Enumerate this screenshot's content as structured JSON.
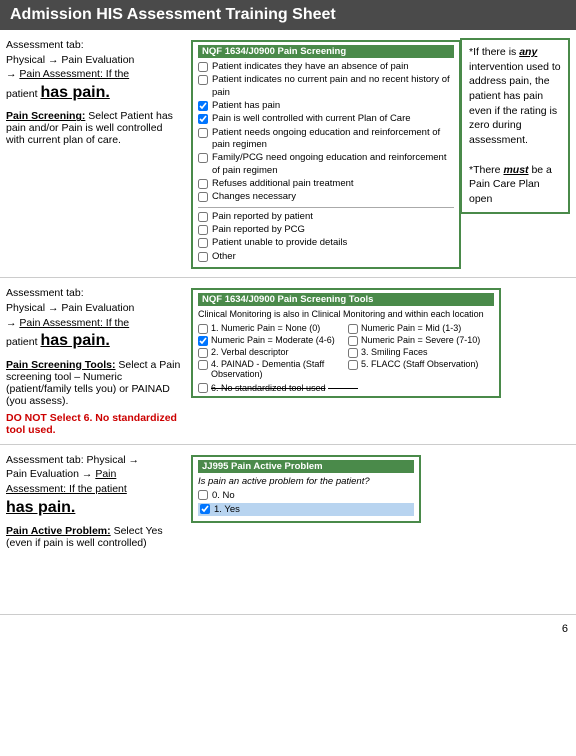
{
  "header": {
    "title": "Admission HIS Assessment Training Sheet"
  },
  "sections": [
    {
      "id": "section1",
      "left": {
        "line1": "Assessment tab:",
        "line2": "Physical → Pain Evaluation",
        "line3": "→ Pain Assessment: If the",
        "line4": "patient",
        "has_pain": "has pain.",
        "blank": "",
        "subheading": "Pain Screening:",
        "subheading_rest": " Select Patient has pain and/or Pain is well controlled with current plan of care."
      },
      "right": {
        "nqf_title": "NQF 1634/J0900 Pain Screening",
        "items": [
          {
            "checked": false,
            "label": "Patient indicates they have an absence of pain"
          },
          {
            "checked": false,
            "label": "Patient indicates no current pain and no recent history of pain"
          },
          {
            "checked": true,
            "label": "Patient has pain"
          },
          {
            "checked": true,
            "label": "Pain is well controlled with current Plan of Care"
          },
          {
            "checked": false,
            "label": "Patient needs ongoing education and reinforcement of pain regimen"
          },
          {
            "checked": false,
            "label": "Family/PCG need ongoing education and reinforcement of pain regimen"
          },
          {
            "checked": false,
            "label": "Refuses additional pain treatment"
          },
          {
            "checked": false,
            "label": "Changes necessary"
          }
        ],
        "divider": true,
        "subitems": [
          {
            "checked": false,
            "label": "Pain reported by patient"
          },
          {
            "checked": false,
            "label": "Pain reported by PCG"
          },
          {
            "checked": false,
            "label": "Patient unable to provide details"
          },
          {
            "checked": false,
            "label": "Other"
          }
        ],
        "note": {
          "line1": "*If there is",
          "any": "any",
          "line2": "intervention used to address pain, the patient has pain even if the rating is zero during assessment.",
          "line3": "",
          "must": "must",
          "line4": "*There",
          "line5": "be a Pain Care Plan open"
        }
      }
    },
    {
      "id": "section2",
      "left": {
        "line1": "Assessment tab:",
        "line2": "Physical → Pain Evaluation",
        "line3": "→ Pain Assessment: If the",
        "line4": "patient",
        "has_pain": "has pain.",
        "blank": "",
        "subheading": "Pain Screening Tools:",
        "subheading_rest": " Select a Pain screening tool – Numeric (patient/family tells you) or PAINAD (you assess).",
        "do_not": "DO NOT Select 6. No standardized tool used."
      },
      "right": {
        "nqf_title": "NQF 1634/J0900 Pain Screening Tools",
        "subtitle": "Clinical Monitoring is also in Clinical Monitoring and within each location",
        "tools": [
          {
            "checked": false,
            "label": "1. Numeric Pain = None (0)",
            "col": 1
          },
          {
            "checked": false,
            "label": "Numeric Pain = Mid (1-3)",
            "col": 2
          },
          {
            "checked": true,
            "label": "Numeric Pain = Moderate (4-6)",
            "col": 1
          },
          {
            "checked": false,
            "label": "Numeric Pain = Severe (7-10)",
            "col": 2
          },
          {
            "checked": false,
            "label": "2. Verbal descriptor",
            "col": 1
          },
          {
            "checked": false,
            "label": "3. Smiling Faces",
            "col": 2
          },
          {
            "checked": false,
            "label": "4. PAINAD - Dementia (Staff Observation)",
            "col": 1
          },
          {
            "checked": false,
            "label": "5. FLACC (Staff Observation)",
            "col": 2
          }
        ],
        "no_tool": {
          "checked": false,
          "label": "6. No standardized tool used"
        }
      }
    },
    {
      "id": "section3",
      "left": {
        "line1": "Assessment tab: Physical →",
        "line2": "Pain Evaluation → ",
        "line3": "Assessment: If the patient",
        "has_pain": "has pain.",
        "blank": "",
        "subheading": "Pain Active Problem:",
        "subheading_rest": " Select Yes (even if pain is well controlled)"
      },
      "right": {
        "nqf_title": "JJ995 Pain Active Problem",
        "question": "Is pain an active problem for the patient?",
        "options": [
          {
            "checked": false,
            "label": "0. No",
            "selected": false
          },
          {
            "checked": true,
            "label": "1. Yes",
            "selected": true
          }
        ]
      }
    }
  ],
  "page_number": "6"
}
